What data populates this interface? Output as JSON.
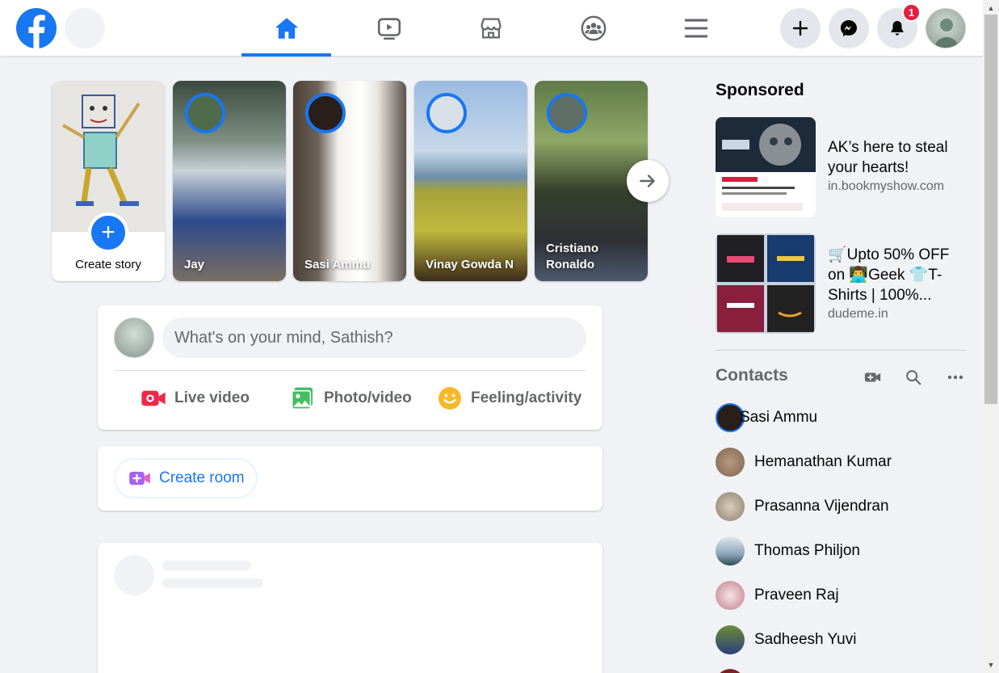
{
  "colors": {
    "brand": "#1877f2",
    "badge": "#e41e3f",
    "live": "#f02849",
    "photo": "#45bd62",
    "feeling": "#f7b928",
    "room": "#a463f2"
  },
  "nav": {
    "tabs": [
      {
        "name": "home",
        "icon": "home-icon",
        "active": true
      },
      {
        "name": "watch",
        "icon": "watch-icon",
        "active": false
      },
      {
        "name": "marketplace",
        "icon": "marketplace-icon",
        "active": false
      },
      {
        "name": "groups",
        "icon": "groups-icon",
        "active": false
      },
      {
        "name": "menu",
        "icon": "hamburger-menu-icon",
        "active": false
      }
    ],
    "notification_count": "1"
  },
  "stories": {
    "create_label": "Create story",
    "items": [
      {
        "name": "Jay"
      },
      {
        "name": "Sasi Ammu"
      },
      {
        "name": "Vinay Gowda N"
      },
      {
        "name": "Cristiano Ronaldo"
      }
    ]
  },
  "composer": {
    "placeholder": "What's on your mind, Sathish?",
    "actions": {
      "live": "Live video",
      "photo": "Photo/video",
      "feeling": "Feeling/activity"
    }
  },
  "room": {
    "label": "Create room"
  },
  "sidebar": {
    "sponsored_title": "Sponsored",
    "ads": [
      {
        "headline": "AK’s here to steal your hearts!",
        "domain": "in.bookmyshow.com"
      },
      {
        "headline": "🛒Upto 50% OFF on 👨‍💻Geek 👕T-Shirts | 100%...",
        "domain": "dudeme.in"
      }
    ],
    "contacts_title": "Contacts",
    "contacts": [
      "Sasi Ammu",
      "Hemanathan Kumar",
      "Prasanna Vijendran",
      "Thomas Philjon",
      "Praveen Raj",
      "Sadheesh Yuvi"
    ]
  }
}
